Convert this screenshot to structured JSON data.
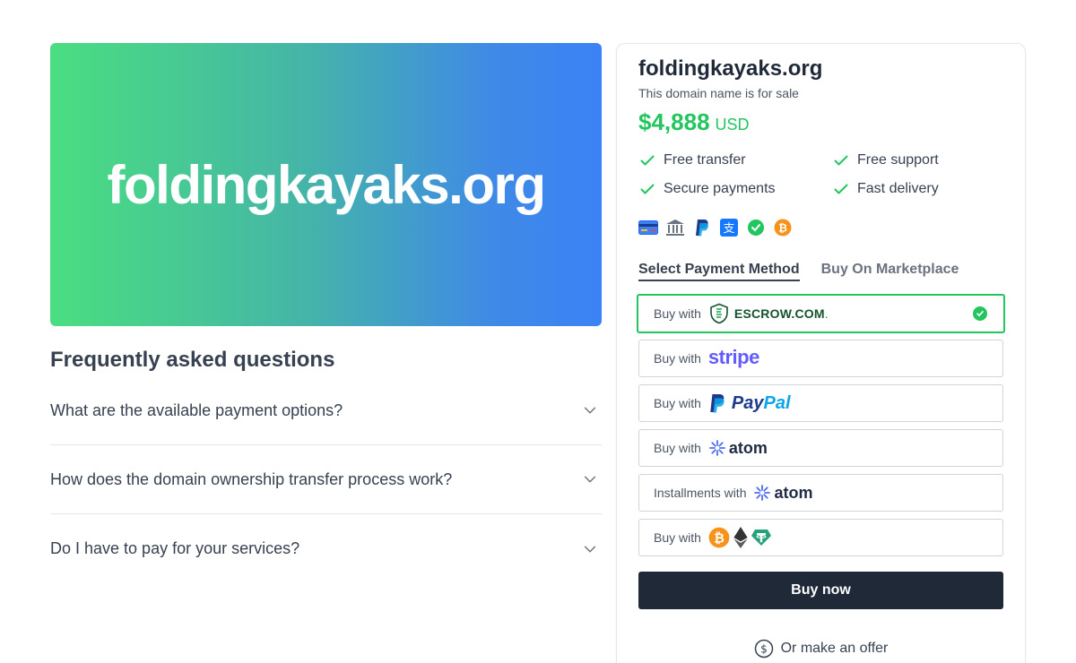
{
  "hero": {
    "title": "foldingkayaks.org"
  },
  "faq": {
    "heading": "Frequently asked questions",
    "items": [
      {
        "question": "What are the available payment options?"
      },
      {
        "question": "How does the domain ownership transfer process work?"
      },
      {
        "question": "Do I have to pay for your services?"
      }
    ]
  },
  "card": {
    "domain": "foldingkayaks.org",
    "subtitle": "This domain name is for sale",
    "price": "$4,888",
    "currency": "USD",
    "features": [
      "Free transfer",
      "Free support",
      "Secure payments",
      "Fast delivery"
    ],
    "payment_icons": [
      "credit-card-icon",
      "bank-icon",
      "paypal-icon",
      "alipay-icon",
      "wechat-pay-icon",
      "bitcoin-icon"
    ],
    "tabs": [
      "Select Payment Method",
      "Buy On Marketplace"
    ],
    "methods": [
      {
        "label": "Buy with",
        "provider": "ESCROW.COM",
        "selected": true
      },
      {
        "label": "Buy with",
        "provider": "stripe"
      },
      {
        "label": "Buy with",
        "provider": "PayPal"
      },
      {
        "label": "Buy with",
        "provider": "atom"
      },
      {
        "label": "Installments with",
        "provider": "atom"
      },
      {
        "label": "Buy with",
        "provider": "crypto"
      }
    ],
    "buy_now": "Buy now",
    "offer": "Or make an offer"
  },
  "colors": {
    "accent_green": "#22c55e",
    "dark_button": "#1f2937",
    "gradient_start": "#4ade80",
    "gradient_end": "#3b82f6"
  }
}
